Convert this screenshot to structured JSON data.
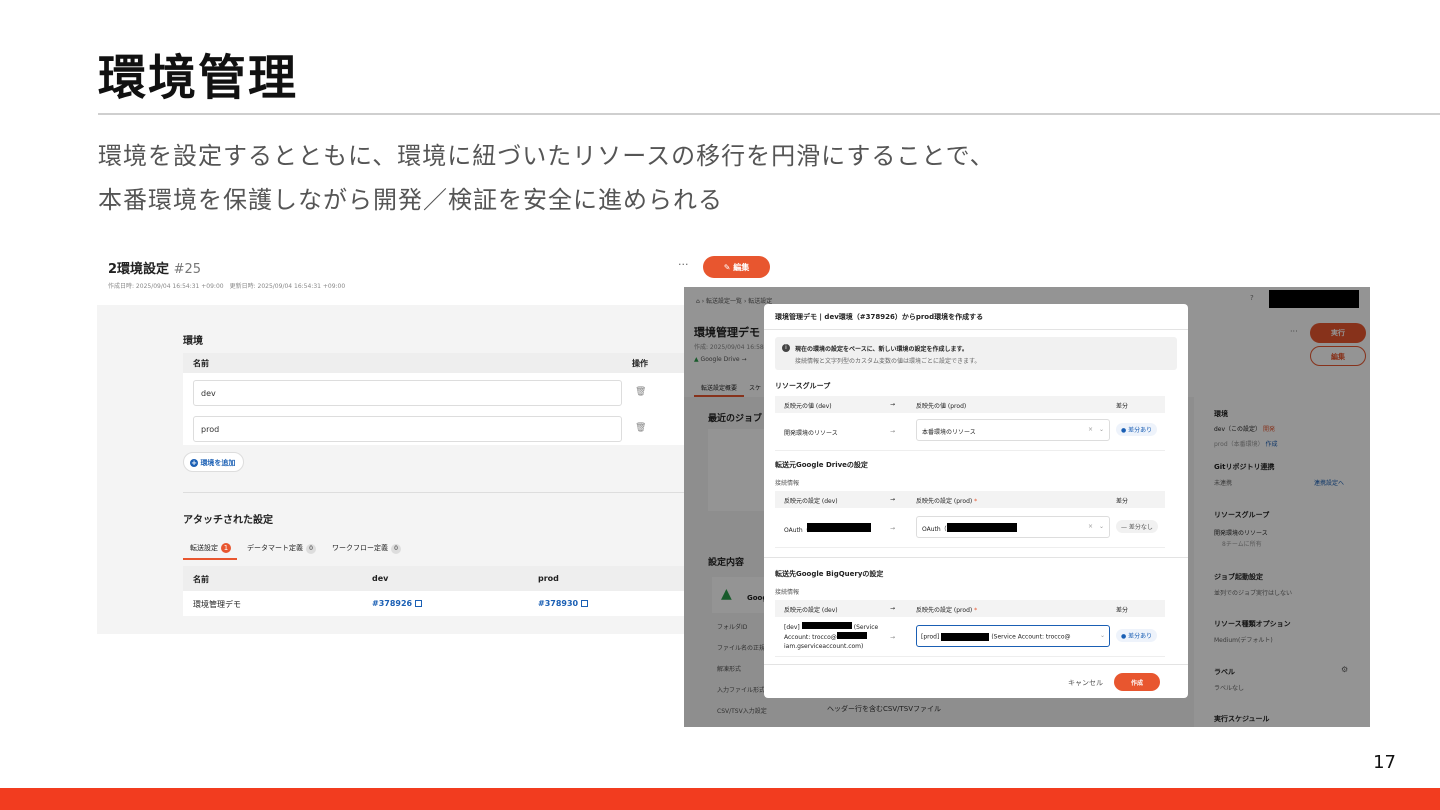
{
  "slide": {
    "title": "環境管理",
    "subtitle_line1": "環境を設定するとともに、環境に紐づいたリソースの移行を円滑にすることで、",
    "subtitle_line2": "本番環境を保護しながら開発／検証を安全に進められる",
    "page_number": "17",
    "accent_color": "#f23c1f"
  },
  "left": {
    "heading": "2環境設定",
    "number": "#25",
    "dates": "作成日時: 2025/09/04 16:54:31 +09:00　更新日時: 2025/09/04 16:54:31 +09:00",
    "more": "···",
    "edit_button": "編集",
    "env_section": "環境",
    "col_name": "名前",
    "col_op": "操作",
    "envs": [
      "dev",
      "prod"
    ],
    "add_env": "環境を追加",
    "attached_title": "アタッチされた設定",
    "tabs": [
      {
        "label": "転送設定",
        "count": "1"
      },
      {
        "label": "データマート定義",
        "count": "0"
      },
      {
        "label": "ワークフロー定義",
        "count": "0"
      }
    ],
    "table_headers": [
      "名前",
      "dev",
      "prod"
    ],
    "table_row": {
      "name": "環境管理デモ",
      "dev": "#378926",
      "prod": "#378930"
    }
  },
  "right_bg": {
    "breadcrumb": "転送設定一覧 › 転送設定",
    "page_title": "環境管理デモ",
    "created": "作成: 2025/09/04 16:58:10 +",
    "source": "Google Drive",
    "tab1": "転送設定概要",
    "tab2": "スケ",
    "recent_jobs": "最近のジョブ",
    "settings": "設定内容",
    "gd_short": "Goog",
    "rows": [
      "フォルダID",
      "ファイル名の正規",
      "解凍形式",
      "入力ファイル形式",
      "CSV/TSV入力設定"
    ],
    "csv_value": "ヘッダー行を含むCSV/TSVファイル",
    "run_button": "実行",
    "edit_button": "編集",
    "more": "···",
    "side": {
      "env": "環境",
      "env_dev": "dev（この設定）",
      "env_dev_badge": "開発",
      "env_prod": "prod（本番環境）",
      "env_prod_badge": "作成",
      "git": "Gitリポジトリ連携",
      "git_val": "未連携",
      "git_link": "連携設定へ",
      "rg": "リソースグループ",
      "rg_val": "開発環境のリソース",
      "rg_sub": "8チームに所有",
      "job_dep": "ジョブ起動設定",
      "job_dep_val": "並列でのジョブ実行はしない",
      "res_opt": "リソース種類オプション",
      "res_opt_val": "Medium(デフォルト)",
      "label": "ラベル",
      "label_val": "ラベルなし",
      "schedule": "実行スケジュール"
    }
  },
  "modal": {
    "title": "環境管理デモ | dev環境（#378926）からprod環境を作成する",
    "info_line1": "現在の環境の設定をベースに、新しい環境の設定を作成します。",
    "info_line2": "接続情報と文字列型のカスタム変数の値は環境ごとに設定できます。",
    "rg_section": "リソースグループ",
    "rg_h_src": "反映元の値 (dev)",
    "rg_h_dst": "反映先の値 (prod)",
    "h_diff": "差分",
    "rg_src": "開発環境のリソース",
    "rg_dst": "本番環境のリソース",
    "diff_yes": "差分あり",
    "diff_no": "差分なし",
    "gd_section": "転送元Google Driveの設定",
    "conn_info": "接続情報",
    "conn_h_src": "反映元の設定 (dev)",
    "conn_h_dst": "反映先の設定 (prod)",
    "required": "*",
    "gd_src": "OAuth（",
    "gd_dst": "OAuth（",
    "bq_section": "転送先Google BigQueryの設定",
    "bq_src_1": "[dev]",
    "bq_src_2": "(Service",
    "bq_src_3": "Account: trocco@",
    "bq_src_4": "iam.gserviceaccount.com)",
    "bq_dst_1": "[prod]",
    "bq_dst_2": "(Service Account: trocco@",
    "cancel": "キャンセル",
    "create": "作成"
  },
  "icons": [
    "pencil-icon",
    "trash-icon",
    "plus-circle-icon",
    "external-link-icon",
    "info-icon",
    "arrow-right-icon",
    "close-icon",
    "chevron-down-icon",
    "home-icon",
    "google-drive-icon",
    "gear-icon",
    "help-icon"
  ]
}
